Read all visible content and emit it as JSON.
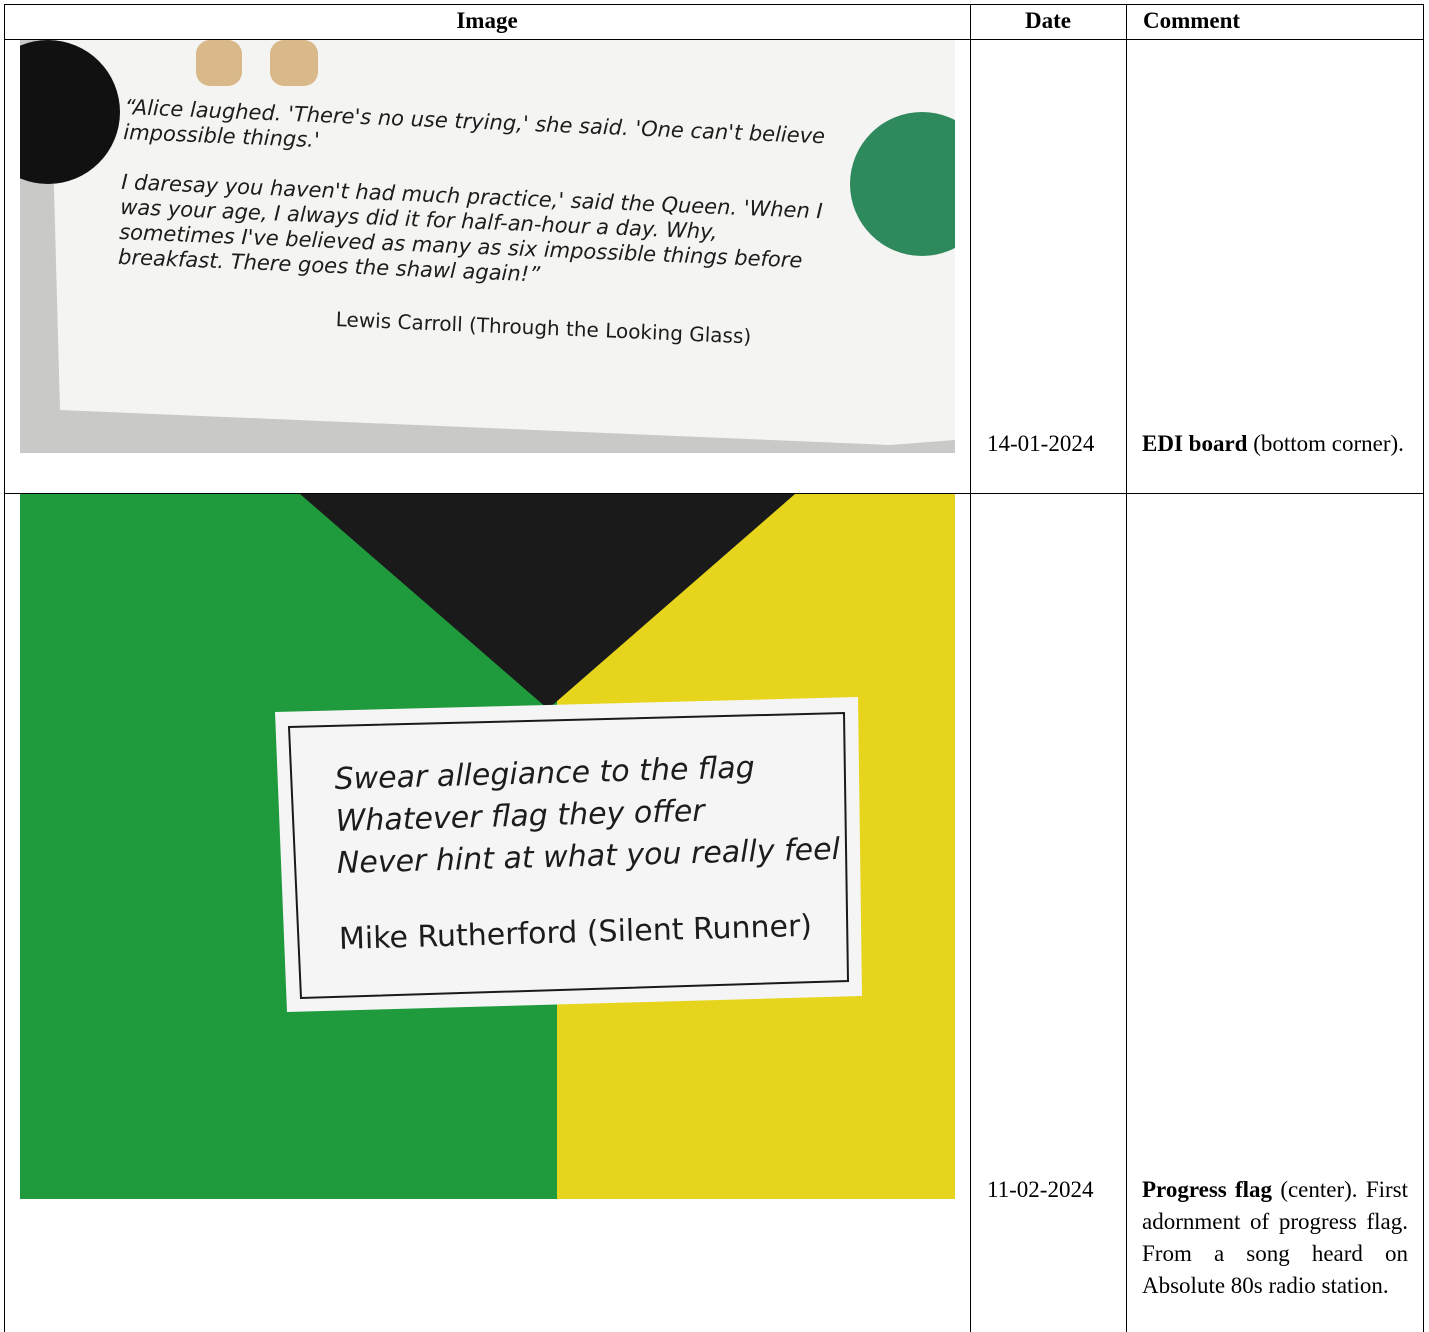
{
  "table": {
    "headers": {
      "image": "Image",
      "date": "Date",
      "comment": "Comment"
    },
    "rows": [
      {
        "date": "14-01-2024",
        "comment_bold": "EDI board",
        "comment_rest": " (bottom corner).",
        "photo": {
          "quote_lines": [
            "“Alice laughed. 'There's no use trying,' she said. 'One can't believe",
            "impossible things.'",
            "I daresay you haven't had much practice,' said the Queen. 'When I",
            "was your age, I always did it for half-an-hour a day. Why,",
            "sometimes I've believed as many as six impossible things before",
            "breakfast. There goes the shawl again!”"
          ],
          "author": "Lewis Carroll (Through the Looking Glass)",
          "colors": {
            "wall": "#c9c9c7",
            "paper": "#f4f4f2",
            "magnet_green": "#2e8a5d",
            "magnet_black": "#111111",
            "peg": "#d9b88a"
          }
        }
      },
      {
        "date": "11-02-2024",
        "comment_bold": "Progress flag",
        "comment_rest": " (center). First adornment of progress flag. From a song heard on Absolute 80s radio station.",
        "photo": {
          "quote_lines": [
            "Swear allegiance to the flag",
            "Whatever flag they offer",
            "Never hint at what you really feel"
          ],
          "author": "Mike Rutherford (Silent Runner)",
          "colors": {
            "green": "#1f9a3c",
            "yellow": "#e6d51c",
            "black": "#1a1a1a",
            "paper": "#f5f5f5"
          }
        }
      }
    ]
  }
}
